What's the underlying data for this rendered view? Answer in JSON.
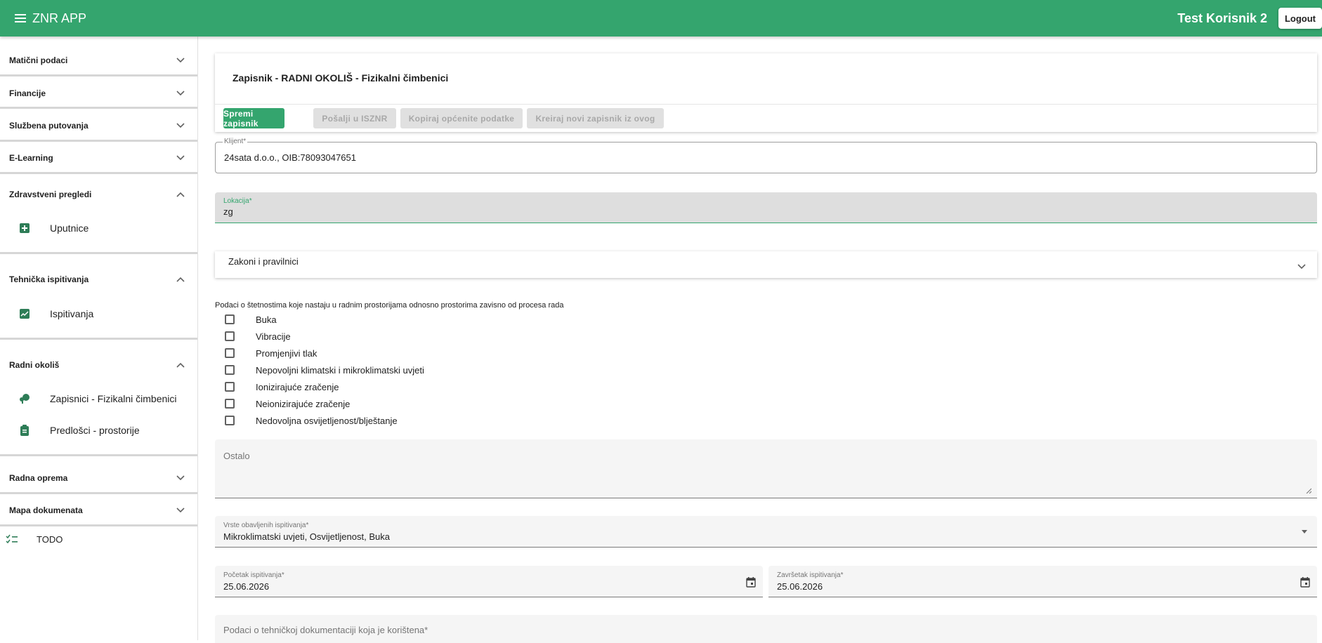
{
  "app": {
    "title": "ZNR APP",
    "user": "Test Korisnik 2",
    "logout_label": "Logout"
  },
  "sidebar": {
    "sections": [
      {
        "label": "Matični podaci",
        "expanded": false
      },
      {
        "label": "Financije",
        "expanded": false
      },
      {
        "label": "Službena putovanja",
        "expanded": false
      },
      {
        "label": "E-Learning",
        "expanded": false
      },
      {
        "label": "Zdravstveni pregledi",
        "expanded": true,
        "items": [
          {
            "label": "Uputnice",
            "icon": "medical-plus-icon"
          }
        ]
      },
      {
        "label": "Tehnička ispitivanja",
        "expanded": true,
        "items": [
          {
            "label": "Ispitivanja",
            "icon": "chart-icon"
          }
        ]
      },
      {
        "label": "Radni okoliš",
        "expanded": true,
        "items": [
          {
            "label": "Zapisnici - Fizikalni čimbenici",
            "icon": "tree-icon"
          },
          {
            "label": "Predlošci - prostorije",
            "icon": "clipboard-icon"
          }
        ]
      },
      {
        "label": "Radna oprema",
        "expanded": false
      },
      {
        "label": "Mapa dokumenata",
        "expanded": false
      }
    ],
    "todo_label": "TODO"
  },
  "form": {
    "title": "Zapisnik - RADNI OKOLIŠ - Fizikalni čimbenici",
    "buttons": {
      "save": "Spremi zapisnik",
      "send": "Pošalji u ISZNR",
      "copy": "Kopiraj općenite podatke",
      "new": "Kreiraj novi zapisnik iz ovog"
    },
    "klijent": {
      "label": "Klijent*",
      "value": "24sata d.o.o., OIB:78093047651"
    },
    "lokacija": {
      "label": "Lokacija*",
      "value": "zg"
    },
    "zakoni": {
      "label": "Zakoni i pravilnici"
    },
    "stetnosti_intro": "Podaci o štetnostima koje nastaju u radnim prostorijama odnosno prostorima zavisno od procesa rada",
    "checkboxes": [
      {
        "label": "Buka",
        "checked": false
      },
      {
        "label": "Vibracije",
        "checked": false
      },
      {
        "label": "Promjenjivi tlak",
        "checked": false
      },
      {
        "label": "Nepovoljni klimatski i mikroklimatski uvjeti",
        "checked": false
      },
      {
        "label": "Ionizirajuće zračenje",
        "checked": false
      },
      {
        "label": "Neionizirajuće zračenje",
        "checked": false
      },
      {
        "label": "Nedovoljna osvijetljenost/blještanje",
        "checked": false
      }
    ],
    "ostalo": {
      "label": "Ostalo"
    },
    "vrste": {
      "label": "Vrste obavljenih ispitivanja*",
      "value": "Mikroklimatski uvjeti, Osvijetljenost, Buka"
    },
    "pocetak": {
      "label": "Početak ispitivanja*",
      "value": "25.06.2026"
    },
    "zavrsetak": {
      "label": "Završetak ispitivanja*",
      "value": "25.06.2026"
    },
    "tehnicka_dok": {
      "label": "Podaci o tehničkoj dokumentaciji koja je korištena*"
    }
  },
  "colors": {
    "primary": "#34a56e",
    "disabled_bg": "#e0e0e0"
  }
}
